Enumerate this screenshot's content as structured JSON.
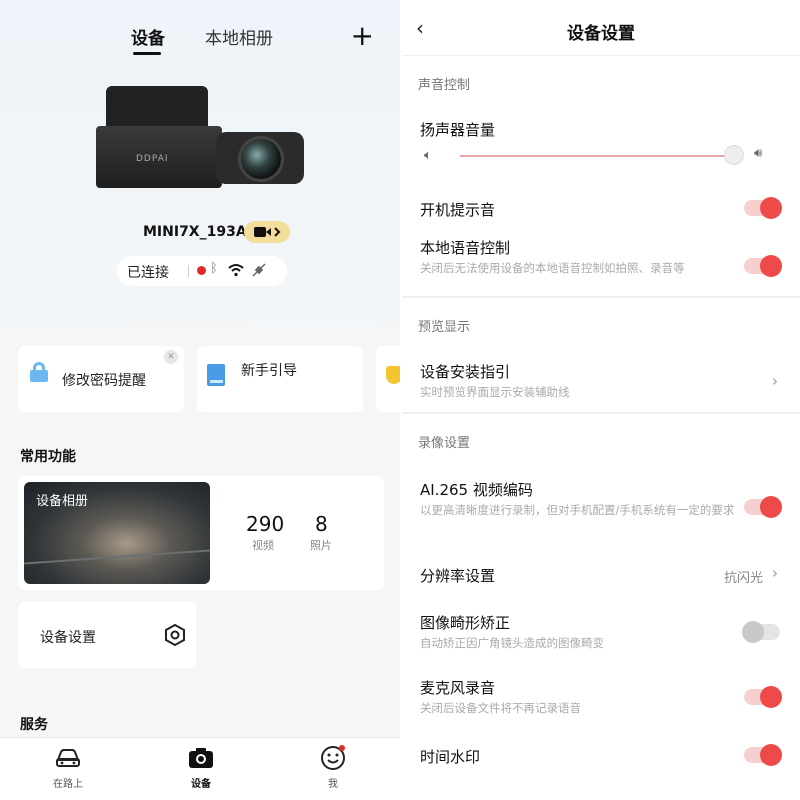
{
  "left": {
    "tabs": [
      {
        "label": "设备"
      },
      {
        "label": "本地相册"
      }
    ],
    "add_icon": "plus-icon",
    "camera_brand": "DDPAI",
    "device_name": "MINI7X_193A",
    "status": {
      "label": "已连接",
      "record_color": "#e02a2a"
    },
    "cards": [
      {
        "label": "修改密码提醒"
      },
      {
        "label": "新手引导"
      }
    ],
    "section_common": "常用功能",
    "album": {
      "label": "设备相册",
      "videos": "290",
      "videos_label": "视频",
      "photos": "8",
      "photos_label": "照片"
    },
    "device_settings": "设备设置",
    "section_service": "服务",
    "nav": [
      {
        "label": "在路上"
      },
      {
        "label": "设备"
      },
      {
        "label": "我"
      }
    ]
  },
  "right": {
    "header_title": "设备设置",
    "groups": {
      "sound": "声音控制",
      "preview": "预览显示",
      "record": "录像设置"
    },
    "speaker_volume": {
      "title": "扬声器音量",
      "level": 0.95
    },
    "startup_sound": {
      "title": "开机提示音",
      "on": true
    },
    "voice_control": {
      "title": "本地语音控制",
      "sub": "关闭后无法使用设备的本地语音控制如拍照、录音等",
      "on": true
    },
    "install_guide": {
      "title": "设备安装指引",
      "sub": "实时预览界面显示安装辅助线"
    },
    "h265": {
      "title": "AI.265 视频编码",
      "sub": "以更高清晰度进行录制，但对手机配置/手机系统有一定的要求",
      "on": true
    },
    "resolution": {
      "title": "分辨率设置",
      "value": "抗闪光"
    },
    "distortion": {
      "title": "图像畸形矫正",
      "sub": "自动矫正因广角镜头造成的图像畸变",
      "on": false
    },
    "mic": {
      "title": "麦克风录音",
      "sub": "关闭后设备文件将不再记录语音",
      "on": true
    },
    "watermark": {
      "title": "时间水印",
      "on": true
    }
  },
  "colors": {
    "accent_red": "#ee4a4a",
    "badge_yellow": "#f3dd9a"
  }
}
